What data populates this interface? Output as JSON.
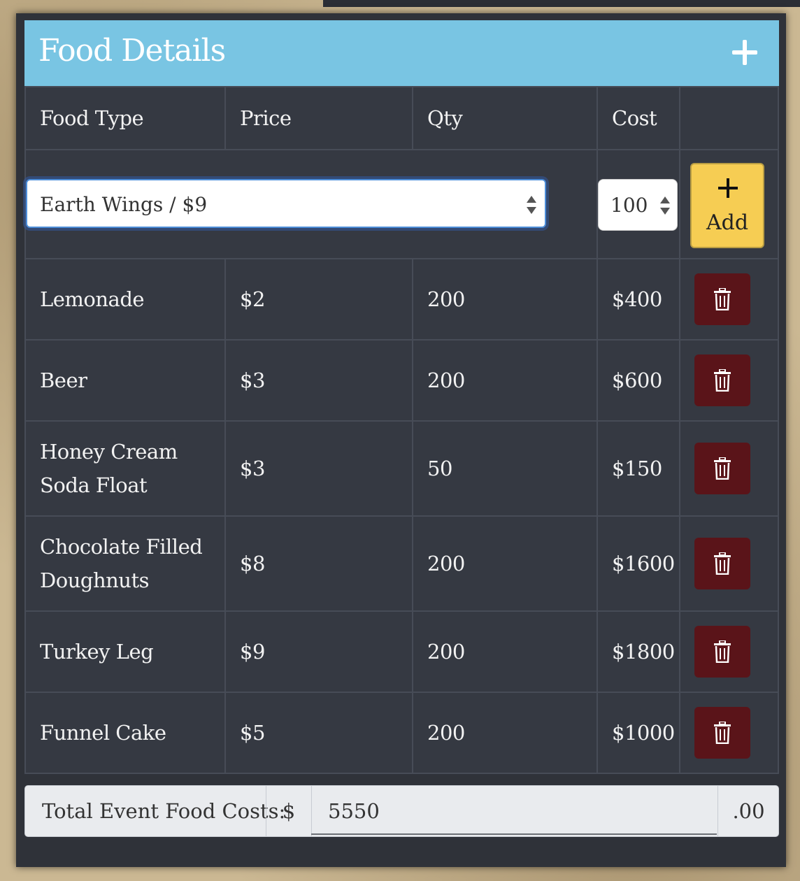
{
  "panel": {
    "title": "Food Details",
    "add_icon": "plus-icon"
  },
  "table": {
    "headers": {
      "food_type": "Food Type",
      "price": "Price",
      "qty": "Qty",
      "cost": "Cost"
    },
    "entry": {
      "selected_food": "Earth Wings / $9",
      "qty_value": "100",
      "add_label": "Add",
      "add_icon": "plus-icon"
    },
    "rows": [
      {
        "food": "Lemonade",
        "price": "$2",
        "qty": "200",
        "cost": "$400"
      },
      {
        "food": "Beer",
        "price": "$3",
        "qty": "200",
        "cost": "$600"
      },
      {
        "food": "Honey Cream Soda Float",
        "price": "$3",
        "qty": "50",
        "cost": "$150"
      },
      {
        "food": "Chocolate Filled Doughnuts",
        "price": "$8",
        "qty": "200",
        "cost": "$1600"
      },
      {
        "food": "Turkey Leg",
        "price": "$9",
        "qty": "200",
        "cost": "$1800"
      },
      {
        "food": "Funnel Cake",
        "price": "$5",
        "qty": "200",
        "cost": "$1000"
      }
    ],
    "delete_icon": "trash-icon"
  },
  "total": {
    "label": "Total Event Food Costs:",
    "currency": "$",
    "value": "5550",
    "cents": ".00"
  },
  "colors": {
    "header": "#79c5e3",
    "table_bg": "#353942",
    "add_button": "#f6cd53",
    "delete_button": "#5a1419"
  }
}
